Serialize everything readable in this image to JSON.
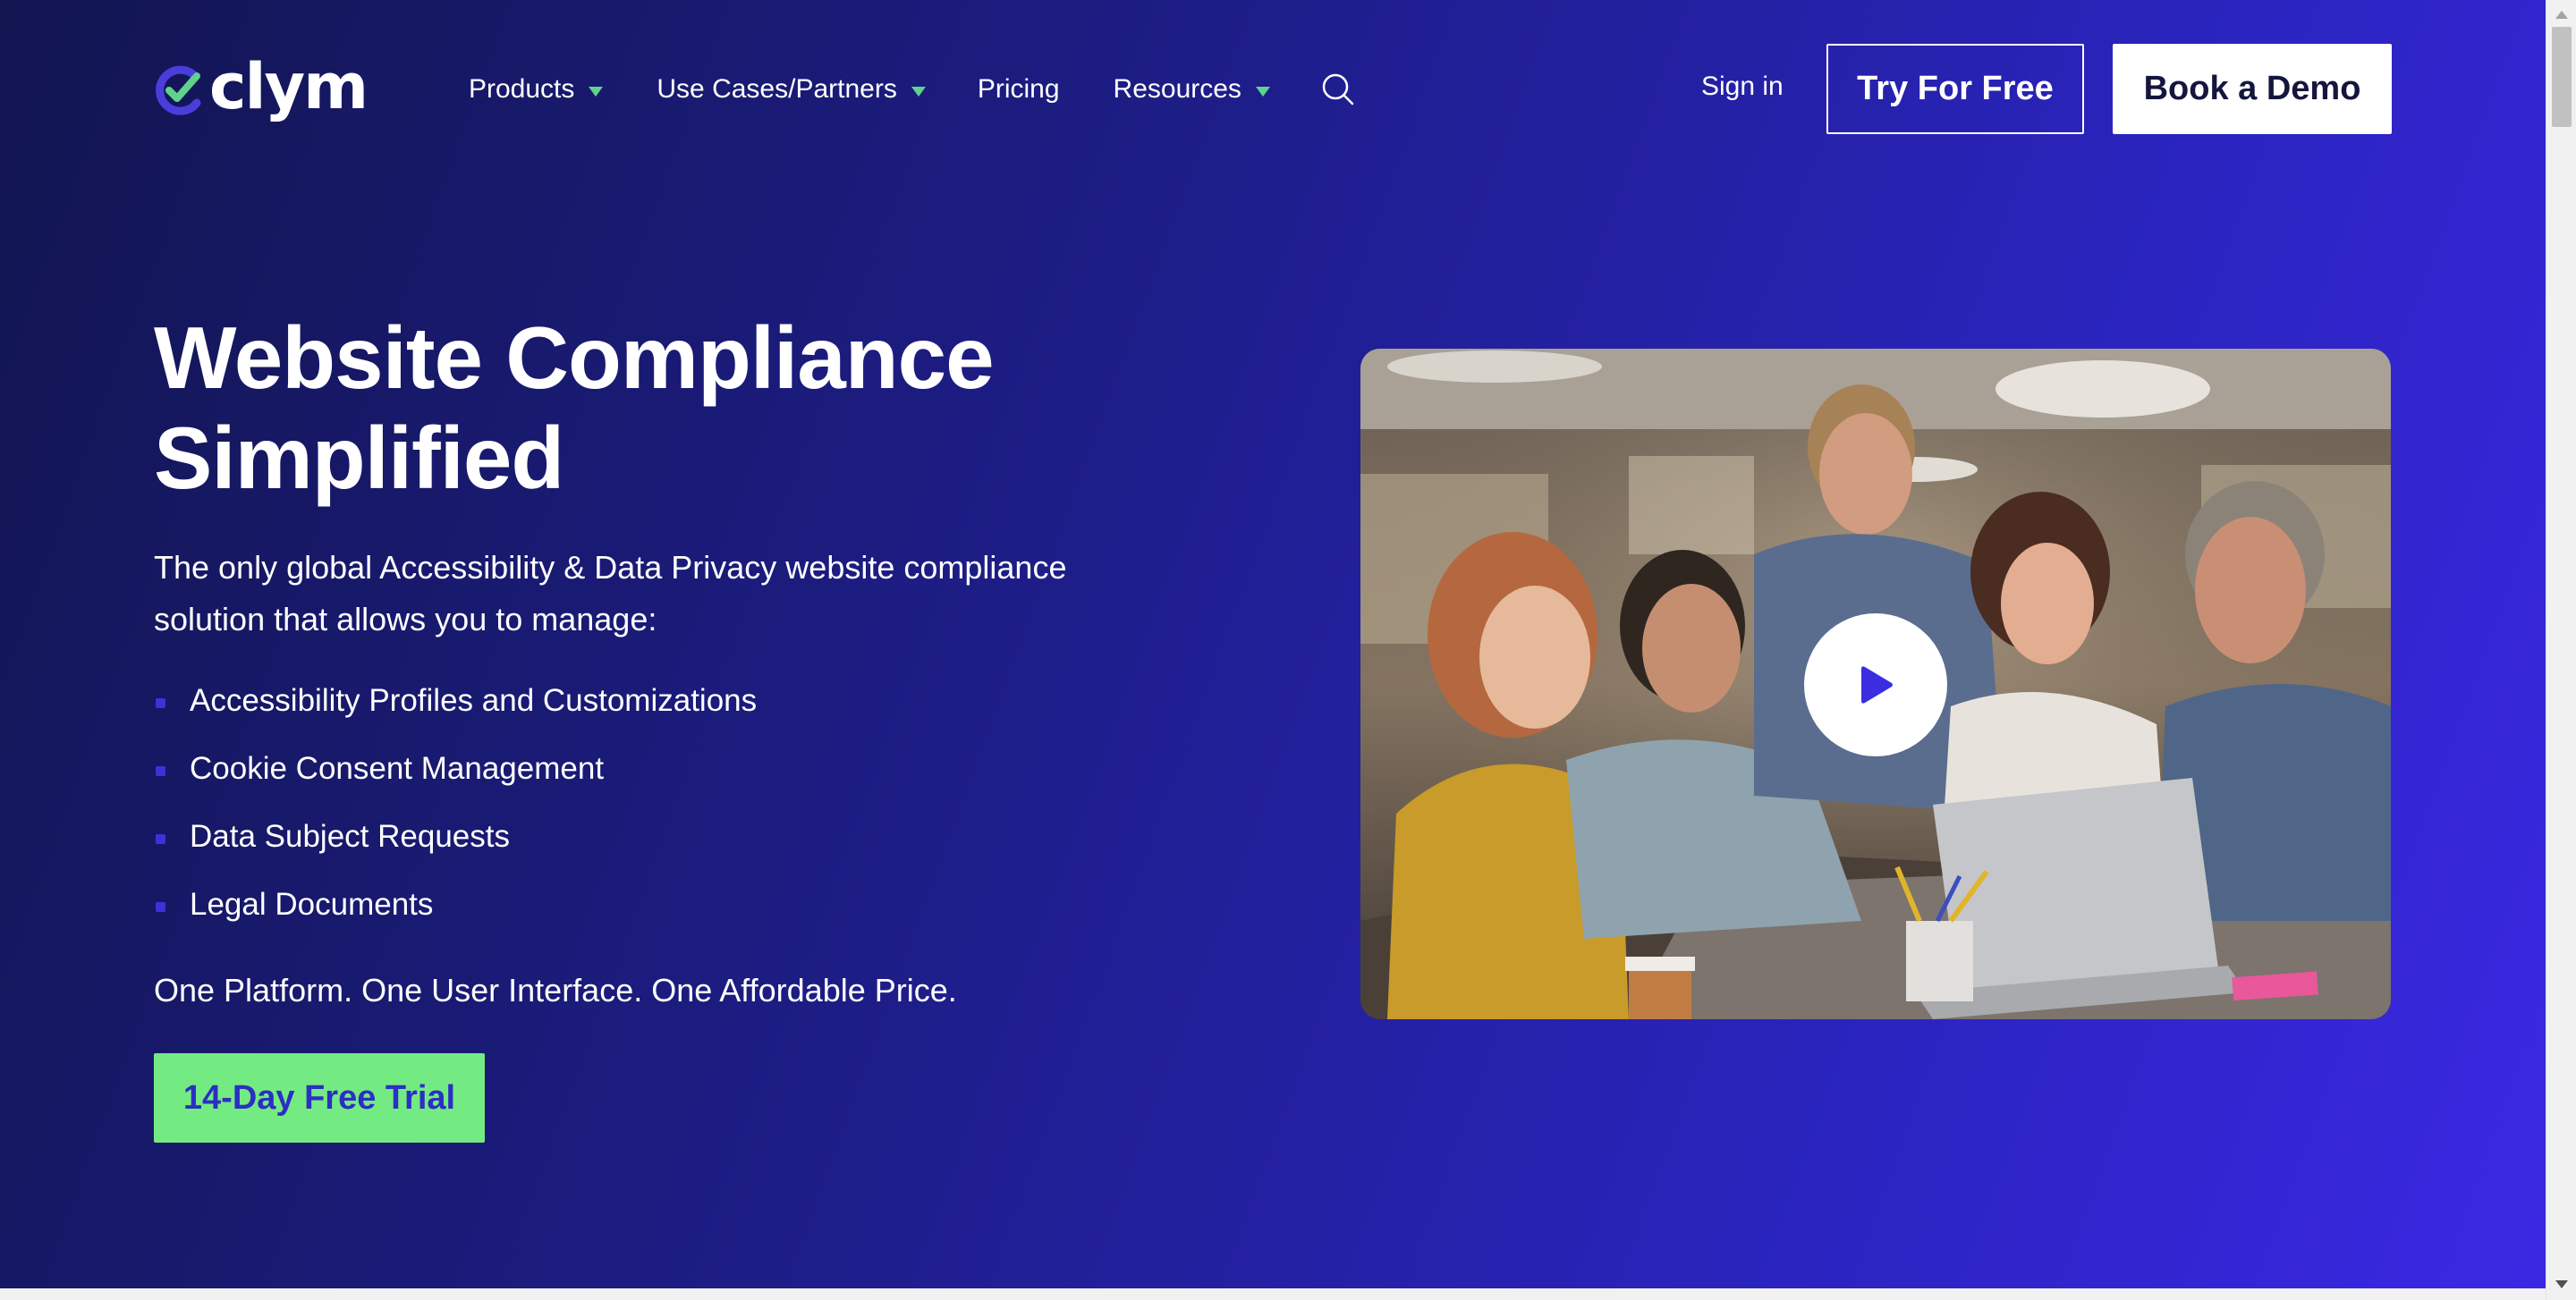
{
  "brand": {
    "name": "clym",
    "logo_icon": "checkmark-c-logo-icon",
    "colors": {
      "logo_purple": "#4b3ddb",
      "logo_green": "#5fd38c"
    }
  },
  "nav": {
    "items": [
      {
        "label": "Products",
        "has_dropdown": true
      },
      {
        "label": "Use Cases/Partners",
        "has_dropdown": true
      },
      {
        "label": "Pricing",
        "has_dropdown": false
      },
      {
        "label": "Resources",
        "has_dropdown": true
      }
    ],
    "search_icon": "search-icon",
    "dropdown_indicator_color": "#5fd38c"
  },
  "header": {
    "signin_label": "Sign in",
    "try_free_label": "Try For Free",
    "book_demo_label": "Book a Demo"
  },
  "hero": {
    "title_line1": "Website Compliance",
    "title_line2": "Simplified",
    "description": "The only global Accessibility & Data Privacy website compliance solution that allows you to manage:",
    "features": [
      "Accessibility Profiles and Customizations",
      "Cookie Consent Management",
      "Data Subject Requests",
      "Legal Documents"
    ],
    "tagline": "One Platform. One User Interface. One Affordable Price.",
    "cta_label": "14-Day Free Trial",
    "colors": {
      "background_start": "#121550",
      "background_end": "#3b28e3",
      "cta_background": "#74ea83",
      "cta_text": "#2b2fc2",
      "bullet": "#3a33d9"
    }
  },
  "video": {
    "thumbnail_description": "team-meeting-photo",
    "play_icon": "play-icon"
  }
}
